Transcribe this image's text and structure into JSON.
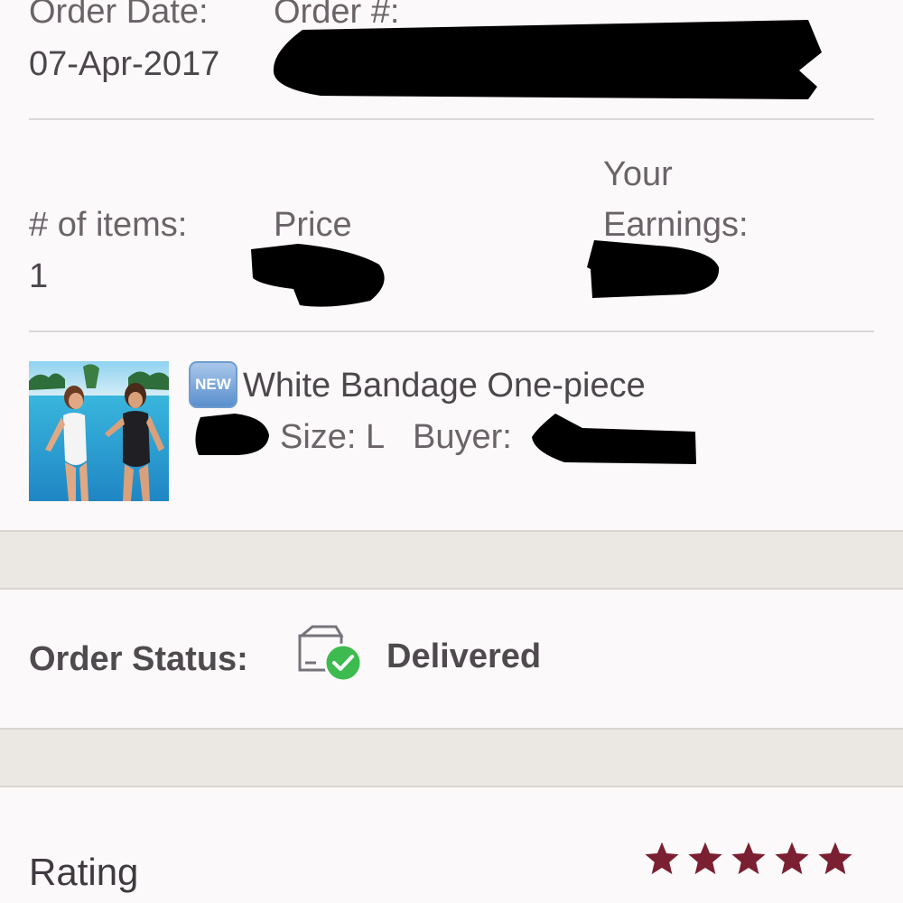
{
  "order": {
    "date_label": "Order Date:",
    "number_label": "Order #:",
    "date_value": "07-Apr-2017"
  },
  "summary": {
    "items_label": "# of items:",
    "items_value": "1",
    "price_label": "Price",
    "earnings_label_line1": "Your",
    "earnings_label_line2": "Earnings:"
  },
  "product": {
    "badge": "NEW",
    "title": "White Bandage One-piece",
    "size_text": "Size: L",
    "buyer_label": "Buyer:"
  },
  "status": {
    "label": "Order Status:",
    "value": "Delivered",
    "icon": "delivered-box-check-icon",
    "check_color": "#3dbb4f"
  },
  "rating": {
    "label": "Rating",
    "stars": 5,
    "max_stars": 5,
    "star_color": "#7b1f32"
  }
}
